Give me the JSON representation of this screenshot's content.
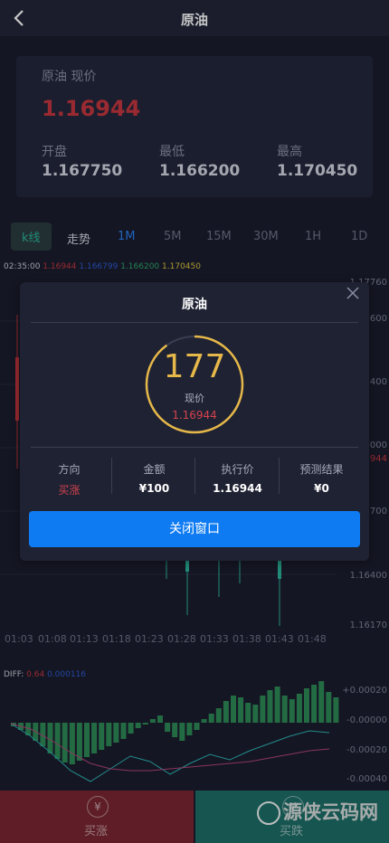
{
  "header": {
    "title": "原油"
  },
  "price_card": {
    "name_label": "原油 现价",
    "current": "1.16944",
    "open_label": "开盘",
    "open": "1.167750",
    "low_label": "最低",
    "low": "1.166200",
    "high_label": "最高",
    "high": "1.170450"
  },
  "tabs": [
    "k线",
    "走势",
    "1M",
    "5M",
    "15M",
    "30M",
    "1H",
    "1D"
  ],
  "ohlc_row": {
    "time": "02:35:00",
    "v1": "1.16944",
    "v2": "1.166799",
    "v3": "1.166200",
    "v4": "1.170450"
  },
  "chart_axis": {
    "y": [
      "1.17760",
      "600",
      "400",
      "0000",
      "944",
      "700",
      "1.16400",
      "1.16170"
    ],
    "x": [
      "01:03",
      "01:08",
      "01:13",
      "01:18",
      "01:23",
      "01:28",
      "01:33",
      "01:38",
      "01:43",
      "01:48"
    ]
  },
  "diff_row": {
    "label": "DIFF:",
    "v1": "0.64",
    "v2": "0.000116"
  },
  "macd_axis": [
    "+0.00020",
    "-0.00000",
    "-0.00020",
    "-0.00040"
  ],
  "modal": {
    "title": "原油",
    "countdown": "177",
    "now_label": "现价",
    "now_price": "1.16944",
    "columns": [
      {
        "header": "方向",
        "value": "买涨"
      },
      {
        "header": "金额",
        "value": "¥100"
      },
      {
        "header": "执行价",
        "value": "1.16944"
      },
      {
        "header": "预测结果",
        "value": "¥0"
      }
    ],
    "close_button": "关闭窗口"
  },
  "bottom": {
    "buy_up": "买涨",
    "buy_down": "买跌",
    "buy_up_icon": "¥",
    "buy_down_icon": "¥"
  },
  "watermark": "源侠云码网",
  "colors": {
    "up": "#c4373f",
    "down": "#1d6e67",
    "accent": "#0e7bf2",
    "ring": "#e6b84a"
  }
}
